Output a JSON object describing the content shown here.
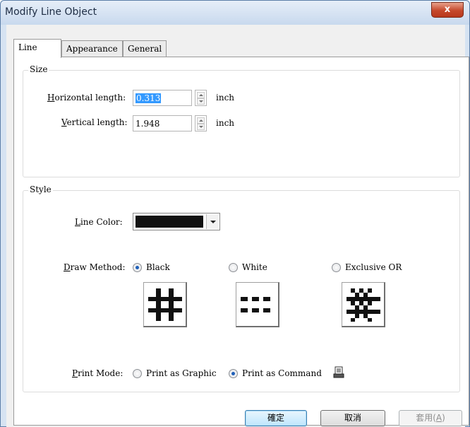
{
  "window": {
    "title": "Modify Line Object",
    "close_glyph": "x"
  },
  "tabs": [
    {
      "label": "Line",
      "active": true
    },
    {
      "label": "Appearance",
      "active": false
    },
    {
      "label": "General",
      "active": false
    }
  ],
  "size": {
    "group_label": "Size",
    "horizontal": {
      "label_key": "H",
      "label_rest": "orizontal length:",
      "value": "0.313",
      "unit": "inch"
    },
    "vertical": {
      "label_key": "V",
      "label_rest": "ertical length:",
      "value": "1.948",
      "unit": "inch"
    }
  },
  "style": {
    "group_label": "Style",
    "line_color": {
      "label_key": "L",
      "label_rest": "ine Color:",
      "value_color": "#111111"
    },
    "draw_method": {
      "label_key": "D",
      "label_rest": "raw Method:",
      "options": [
        {
          "label": "Black",
          "selected": true
        },
        {
          "label": "White",
          "selected": false
        },
        {
          "label": "Exclusive OR",
          "selected": false
        }
      ]
    },
    "print_mode": {
      "label_key": "P",
      "label_rest": "rint Mode:",
      "options": [
        {
          "label": "Print as Graphic",
          "selected": false
        },
        {
          "label": "Print as Command",
          "selected": true
        }
      ]
    }
  },
  "buttons": {
    "ok": "確定",
    "cancel": "取消",
    "apply_text": "套用(",
    "apply_key": "A",
    "apply_close": ")"
  },
  "colors": {
    "title_bar": "#d6e3f2",
    "close_button": "#c5482b",
    "selection": "#3399ff",
    "default_button": "#bee6fd"
  }
}
